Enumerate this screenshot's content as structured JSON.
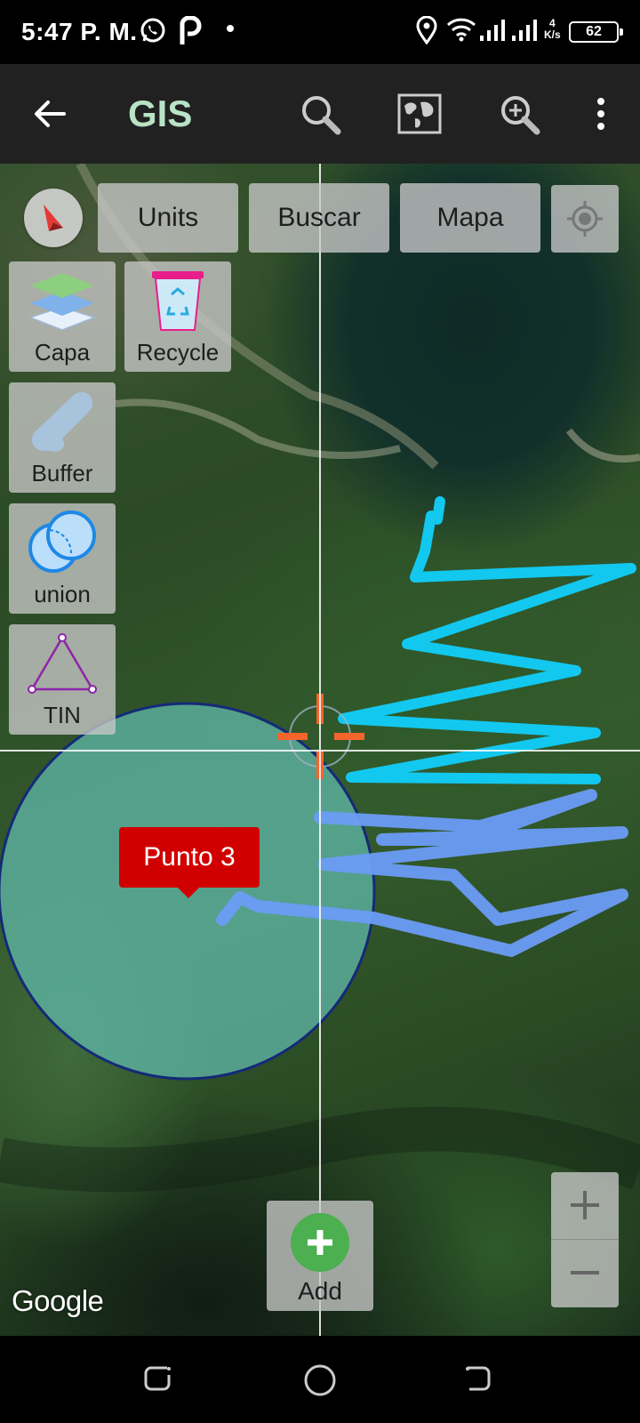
{
  "status_bar": {
    "time": "5:47 P. M.",
    "speed_value": "4",
    "speed_unit": "K/s",
    "battery": "62",
    "icons": [
      "whatsapp-icon",
      "p-app-icon",
      "notification-dot",
      "location-icon",
      "wifi-icon",
      "signal-icon",
      "signal-icon"
    ]
  },
  "app_bar": {
    "title": "GIS",
    "actions": [
      "back-arrow-icon",
      "search-icon",
      "map-icon",
      "zoom-in-icon",
      "overflow-menu-icon"
    ]
  },
  "map": {
    "top_buttons": {
      "units": "Units",
      "buscar": "Buscar",
      "mapa": "Mapa"
    },
    "tools": [
      {
        "label": "Capa",
        "icon": "layers-icon"
      },
      {
        "label": "Recycle",
        "icon": "recycle-bin-icon"
      },
      {
        "label": "Buffer",
        "icon": "buffer-icon"
      },
      {
        "label": "union",
        "icon": "union-icon"
      },
      {
        "label": "TIN",
        "icon": "tin-triangle-icon"
      }
    ],
    "marker_label": "Punto 3",
    "add_label": "Add",
    "attribution": "Google",
    "colors": {
      "buffer_fill": "#5fb5a5",
      "buffer_stroke": "#142a78",
      "line_cyan": "#12c8ef",
      "line_blue": "#6b9cf5",
      "popup_red": "#d10000",
      "add_green": "#4caf50",
      "app_title": "#b9e3c6"
    }
  }
}
